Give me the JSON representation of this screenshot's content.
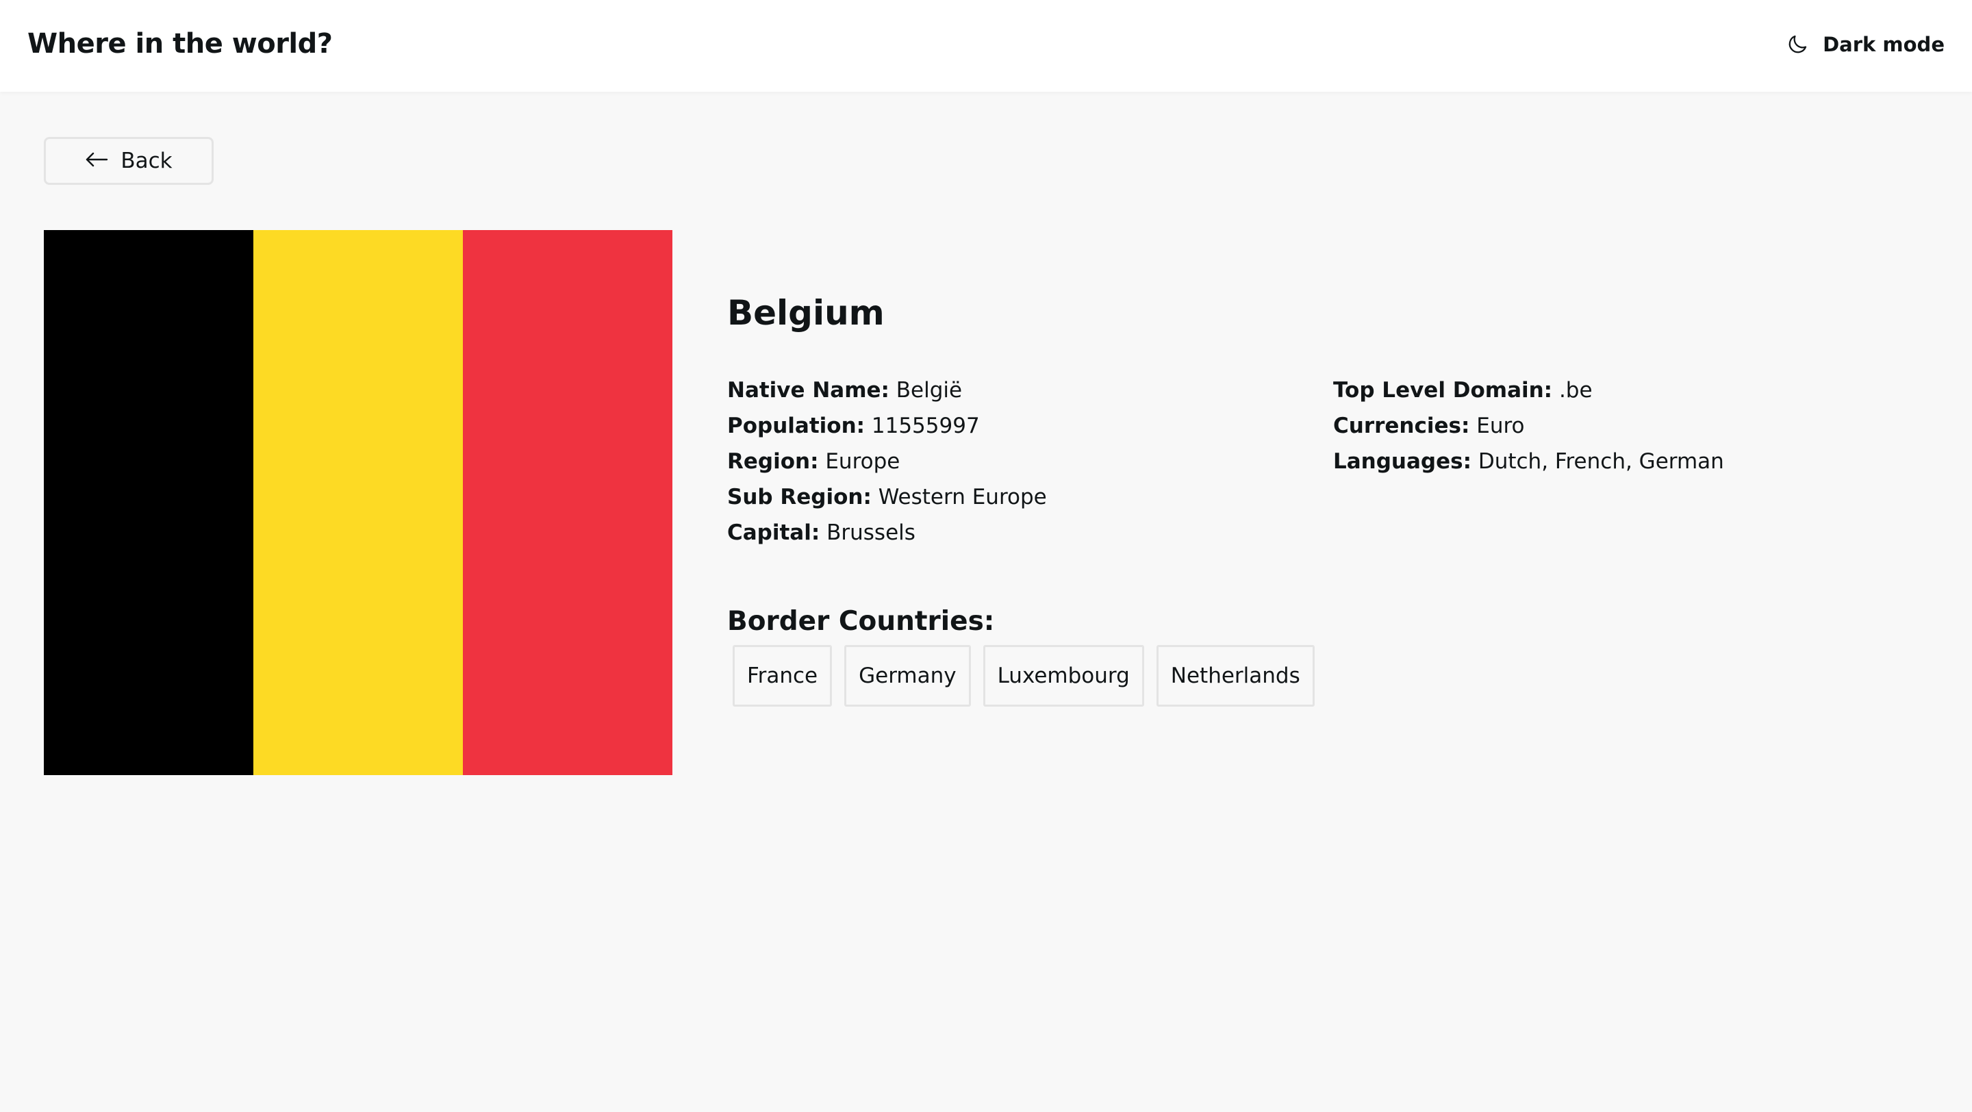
{
  "header": {
    "app_title": "Where in the world?",
    "dark_mode_label": "Dark mode",
    "dark_mode_icon": "moon-icon"
  },
  "back_button": {
    "label": "Back",
    "icon": "arrow-left-icon"
  },
  "country": {
    "name": "Belgium",
    "flag_colors": [
      "#000000",
      "#fdda24",
      "#ef3340"
    ],
    "details_left": [
      {
        "label": "Native Name:",
        "value": "België"
      },
      {
        "label": "Population:",
        "value": "11555997"
      },
      {
        "label": "Region:",
        "value": "Europe"
      },
      {
        "label": "Sub Region:",
        "value": "Western Europe"
      },
      {
        "label": "Capital:",
        "value": "Brussels"
      }
    ],
    "details_right": [
      {
        "label": "Top Level Domain:",
        "value": ".be"
      },
      {
        "label": "Currencies:",
        "value": "Euro"
      },
      {
        "label": "Languages:",
        "value": "Dutch, French, German"
      }
    ],
    "border_title": "Border Countries:",
    "border_countries": [
      "France",
      "Germany",
      "Luxembourg",
      "Netherlands"
    ]
  }
}
